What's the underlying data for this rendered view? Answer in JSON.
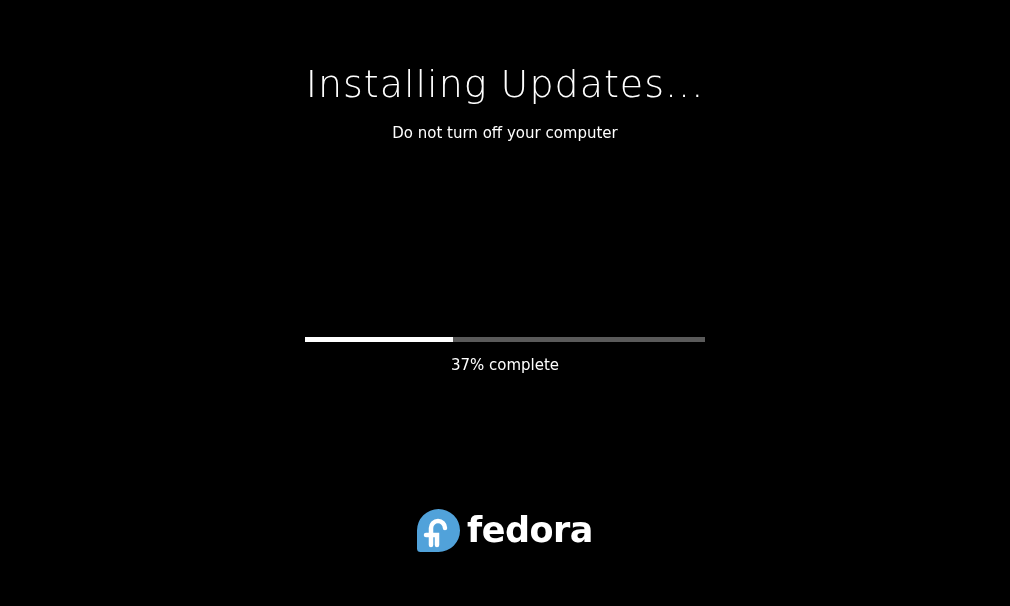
{
  "title": "Installing Updates...",
  "subtitle": "Do not turn off your computer",
  "progress": {
    "level": 0.37,
    "reading": "37% complete"
  },
  "logo": {
    "wordmark": "fedora"
  }
}
